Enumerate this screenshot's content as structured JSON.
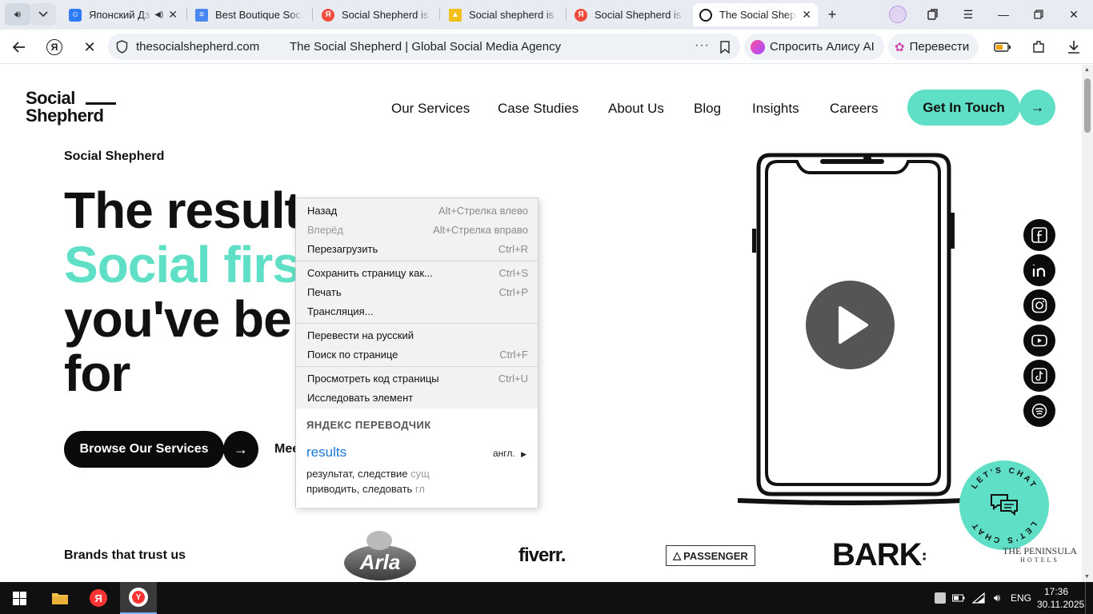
{
  "browser": {
    "tabs": [
      {
        "title": "Японский Дз",
        "favicon": "smile-icon",
        "favicon_color": "#2f7bf5",
        "sound": true,
        "active": false
      },
      {
        "title": "Best Boutique Soci",
        "favicon": "doc-icon",
        "favicon_color": "#4a86f0",
        "active": false
      },
      {
        "title": "Social Shepherd is a",
        "favicon": "yandex-icon",
        "favicon_color": "#f04b3b",
        "active": false
      },
      {
        "title": "Social shepherd is a",
        "favicon": "image-icon",
        "favicon_color": "#f3c019",
        "active": false
      },
      {
        "title": "Social Shepherd is a",
        "favicon": "yandex-icon",
        "favicon_color": "#f04b3b",
        "active": false
      },
      {
        "title": "The Social Shepher",
        "favicon": "circle-icon",
        "favicon_color": "#111111",
        "active": true
      }
    ],
    "url": "thesocialshepherd.com",
    "page_title": "The Social Shepherd | Global Social Media Agency",
    "alice_label": "Спросить Алису AI",
    "translate_label": "Перевести"
  },
  "site": {
    "logo_line1": "Social",
    "logo_line2": "Shepherd",
    "nav": [
      "Our Services",
      "Case Studies",
      "About Us",
      "Blog",
      "Insights",
      "Careers"
    ],
    "cta_label": "Get In Touch",
    "eyebrow": "Social Shepherd",
    "hero_line1": "The result",
    "hero_line2": "Social firs",
    "hero_line3": "you've be",
    "hero_line4": "for",
    "browse_label": "Browse Our Services",
    "meet_label": "Mee",
    "brands_label": "Brands that trust us",
    "brands": [
      "Arla",
      "fiverr.",
      "PASSENGER",
      "BARK",
      "THE PENINSULA",
      "HOTELS"
    ],
    "chat_badge": "LET'S CHAT",
    "accent_color": "#5fe0c6"
  },
  "context_menu": {
    "items": [
      {
        "label": "Назад",
        "shortcut": "Alt+Стрелка влево",
        "disabled": false
      },
      {
        "label": "Вперёд",
        "shortcut": "Alt+Стрелка вправо",
        "disabled": true
      },
      {
        "label": "Перезагрузить",
        "shortcut": "Ctrl+R",
        "disabled": false
      },
      {
        "label": "Сохранить страницу как...",
        "shortcut": "Ctrl+S",
        "disabled": false
      },
      {
        "label": "Печать",
        "shortcut": "Ctrl+P",
        "disabled": false
      },
      {
        "label": "Трансляция...",
        "shortcut": "",
        "disabled": false
      },
      {
        "label": "Перевести на русский",
        "shortcut": "",
        "disabled": false
      },
      {
        "label": "Поиск по странице",
        "shortcut": "Ctrl+F",
        "disabled": false
      },
      {
        "label": "Просмотреть код страницы",
        "shortcut": "Ctrl+U",
        "disabled": false
      },
      {
        "label": "Исследовать элемент",
        "shortcut": "",
        "disabled": false
      }
    ],
    "translator_header": "ЯНДЕКС ПЕРЕВОДЧИК",
    "word": "results",
    "lang": "англ.",
    "meaning1": "результат, следствие",
    "meaning1_pos": "сущ",
    "meaning2": "приводить, следовать",
    "meaning2_pos": "гл"
  },
  "taskbar": {
    "lang": "ENG",
    "time": "17:36",
    "date": "30.11.2025"
  }
}
